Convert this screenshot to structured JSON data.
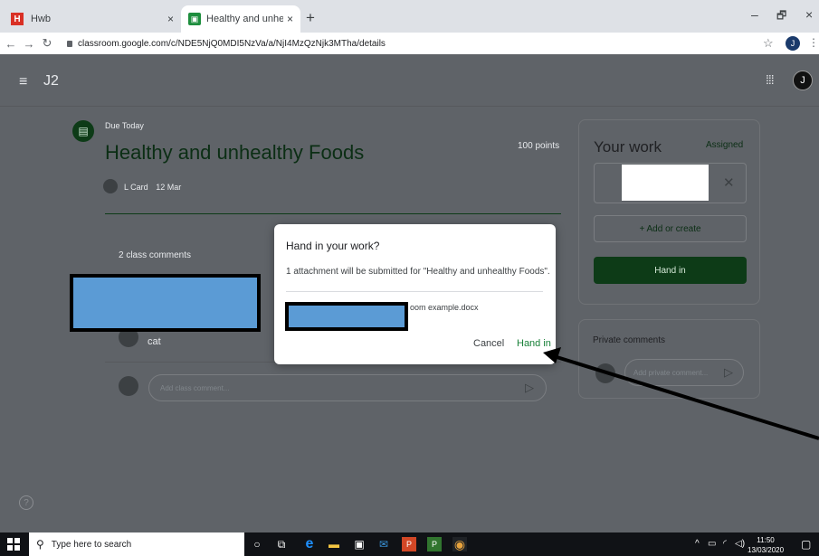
{
  "browser": {
    "tabs": [
      {
        "label": "Hwb",
        "favicon": "H"
      },
      {
        "label": "Healthy and unhealthy Foods",
        "favicon": "classroom-icon"
      }
    ],
    "close_glyph": "×",
    "new_tab_glyph": "+",
    "url": "classroom.google.com/c/NDE5NjQ0MDI5NzVa/a/NjI4MzQzNjk3MTha/details",
    "profile_initial": "J",
    "window_controls": {
      "minimize": "–",
      "maximize": "🗗",
      "close": "×"
    }
  },
  "app": {
    "class_name": "J2",
    "profile_initial": "J"
  },
  "assignment": {
    "due": "Due Today",
    "title": "Healthy and unhealthy Foods",
    "points": "100 points",
    "author": "L Card",
    "date": "12 Mar",
    "comments_count": "2 class comments",
    "commenter": "cat",
    "class_comment_placeholder": "Add class comment..."
  },
  "your_work": {
    "title": "Your work",
    "status": "Assigned",
    "add_label": "+  Add or create",
    "hand_in_label": "Hand in"
  },
  "private_comments": {
    "title": "Private comments",
    "placeholder": "Add private comment..."
  },
  "dialog": {
    "title": "Hand in your work?",
    "message": "1 attachment will be submitted for \"Healthy and unhealthy Foods\".",
    "file_suffix": "oom example.docx",
    "cancel_label": "Cancel",
    "hand_in_label": "Hand in"
  },
  "taskbar": {
    "search_placeholder": "Type here to search",
    "time": "11:50",
    "date": "13/03/2020"
  },
  "colors": {
    "accent_green": "#188038",
    "dark_green": "#0d3b17",
    "redaction_blue": "#5b9bd5"
  },
  "help_glyph": "?"
}
